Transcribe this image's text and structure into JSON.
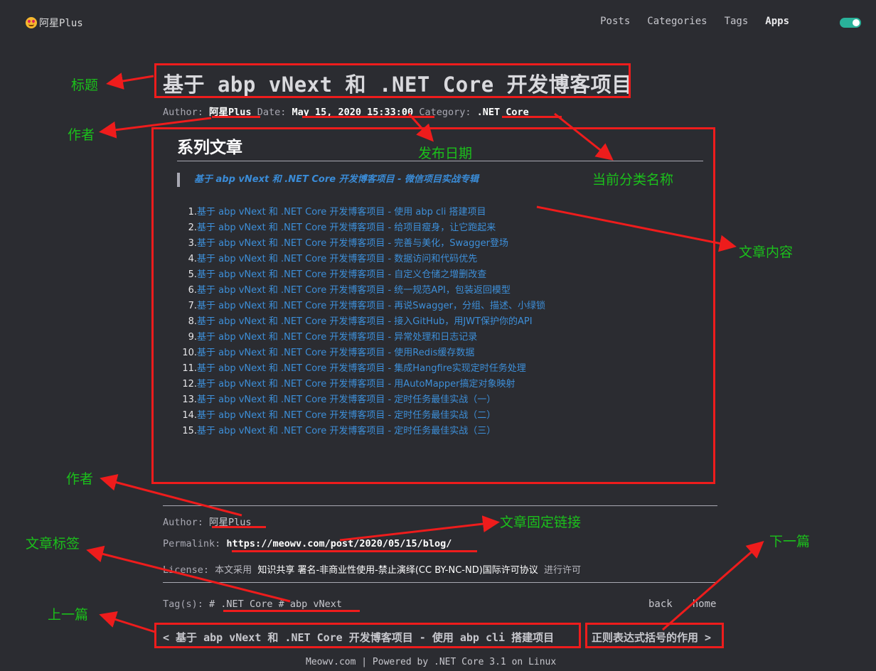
{
  "header": {
    "logo_text": "阿星Plus",
    "logo_icon": "star-struck-emoji-icon",
    "nav": [
      "Posts",
      "Categories",
      "Tags",
      "Apps"
    ],
    "active_nav": "Apps"
  },
  "post": {
    "title": "基于 abp vNext 和 .NET Core 开发博客项目",
    "meta": {
      "author_label": "Author:",
      "author": "阿星Plus",
      "date_label": "Date:",
      "date": "May 15, 2020 15:33:00",
      "category_label": "Category:",
      "category": ".NET Core"
    },
    "series_heading": "系列文章",
    "series_quote": "基于 abp vNext 和 .NET Core 开发博客项目 - 微信项目实战专辑",
    "articles": [
      "基于 abp vNext 和 .NET Core 开发博客项目 - 使用 abp cli 搭建项目",
      "基于 abp vNext 和 .NET Core 开发博客项目 - 给项目瘦身，让它跑起来",
      "基于 abp vNext 和 .NET Core 开发博客项目 - 完善与美化，Swagger登场",
      "基于 abp vNext 和 .NET Core 开发博客项目 - 数据访问和代码优先",
      "基于 abp vNext 和 .NET Core 开发博客项目 - 自定义仓储之增删改查",
      "基于 abp vNext 和 .NET Core 开发博客项目 - 统一规范API，包装返回模型",
      "基于 abp vNext 和 .NET Core 开发博客项目 - 再说Swagger，分组、描述、小绿锁",
      "基于 abp vNext 和 .NET Core 开发博客项目 - 接入GitHub，用JWT保护你的API",
      "基于 abp vNext 和 .NET Core 开发博客项目 - 异常处理和日志记录",
      "基于 abp vNext 和 .NET Core 开发博客项目 - 使用Redis缓存数据",
      "基于 abp vNext 和 .NET Core 开发博客项目 - 集成Hangfire实现定时任务处理",
      "基于 abp vNext 和 .NET Core 开发博客项目 - 用AutoMapper搞定对象映射",
      "基于 abp vNext 和 .NET Core 开发博客项目 - 定时任务最佳实战（一）",
      "基于 abp vNext 和 .NET Core 开发博客项目 - 定时任务最佳实战（二）",
      "基于 abp vNext 和 .NET Core 开发博客项目 - 定时任务最佳实战（三）"
    ]
  },
  "post_footer": {
    "author_label": "Author:",
    "author": "阿星Plus",
    "permalink_label": "Permalink:",
    "permalink": "https://meowv.com/post/2020/05/15/blog/",
    "license_label": "License:",
    "license_prefix": "本文采用",
    "license_name": "知识共享 署名-非商业性使用-禁止演绎(CC BY-NC-ND)国际许可协议",
    "license_suffix": "进行许可",
    "tags_label": "Tag(s):",
    "tags_text": "# .NET Core # abp vNext",
    "back": "back",
    "home": "home",
    "prev": "< 基于 abp vNext 和 .NET Core 开发博客项目 - 使用 abp cli 搭建项目",
    "next": "正则表达式括号的作用 >"
  },
  "site_footer": "Meowv.com | Powered by .NET Core 3.1 on Linux",
  "annotations": {
    "title": "标题",
    "author_top": "作者",
    "publish_date": "发布日期",
    "category_name": "当前分类名称",
    "content": "文章内容",
    "author_bottom": "作者",
    "permalink": "文章固定链接",
    "tags": "文章标签",
    "next": "下一篇",
    "prev": "上一篇",
    "color": "#ee1c1c",
    "label_color": "#1bc01b"
  }
}
